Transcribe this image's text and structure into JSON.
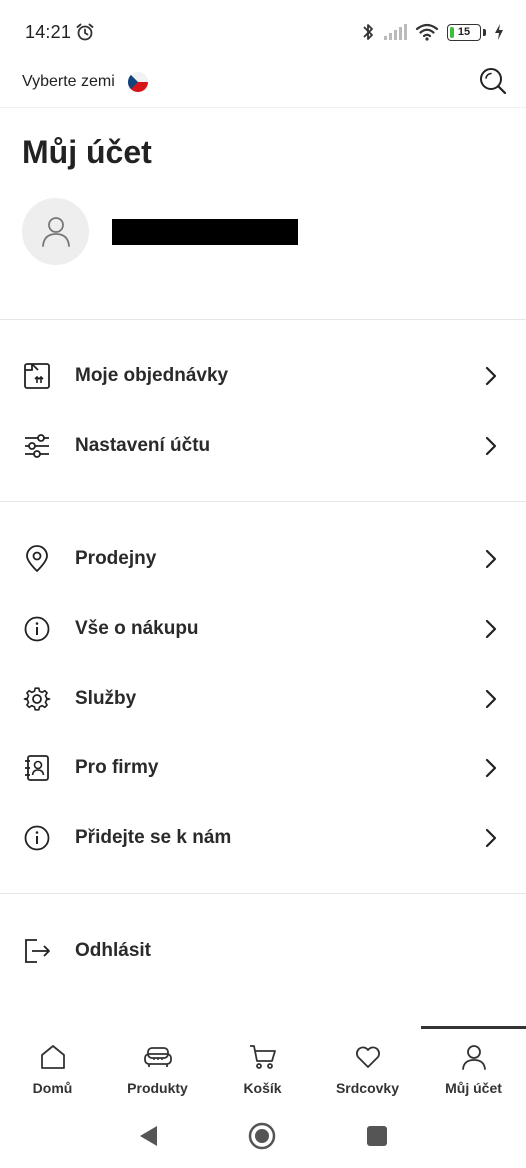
{
  "status_bar": {
    "time": "14:21",
    "battery_level": "15",
    "battery_fraction": 0.15
  },
  "header": {
    "country_label": "Vyberte zemi",
    "flag": "czech-flag-icon",
    "search_icon": "search-icon"
  },
  "page": {
    "title": "Můj účet"
  },
  "menu_group_1": [
    {
      "label": "Moje objednávky",
      "icon": "package-icon"
    },
    {
      "label": "Nastavení účtu",
      "icon": "sliders-icon"
    }
  ],
  "menu_group_2": [
    {
      "label": "Prodejny",
      "icon": "location-pin-icon"
    },
    {
      "label": "Vše o nákupu",
      "icon": "info-icon"
    },
    {
      "label": "Služby",
      "icon": "gear-icon"
    },
    {
      "label": "Pro firmy",
      "icon": "contact-book-icon"
    },
    {
      "label": "Přidejte se k nám",
      "icon": "info-icon"
    }
  ],
  "logout": {
    "label": "Odhlásit",
    "icon": "logout-icon"
  },
  "bottom_nav": [
    {
      "label": "Domů",
      "icon": "home-icon"
    },
    {
      "label": "Produkty",
      "icon": "sofa-icon"
    },
    {
      "label": "Košík",
      "icon": "cart-icon"
    },
    {
      "label": "Srdcovky",
      "icon": "heart-icon"
    },
    {
      "label": "Můj účet",
      "icon": "user-icon",
      "active": true
    }
  ],
  "colors": {
    "text": "#222222",
    "divider": "#e6e6e6",
    "avatar_bg": "#eeeeee",
    "battery_green": "#3bbf3b"
  }
}
